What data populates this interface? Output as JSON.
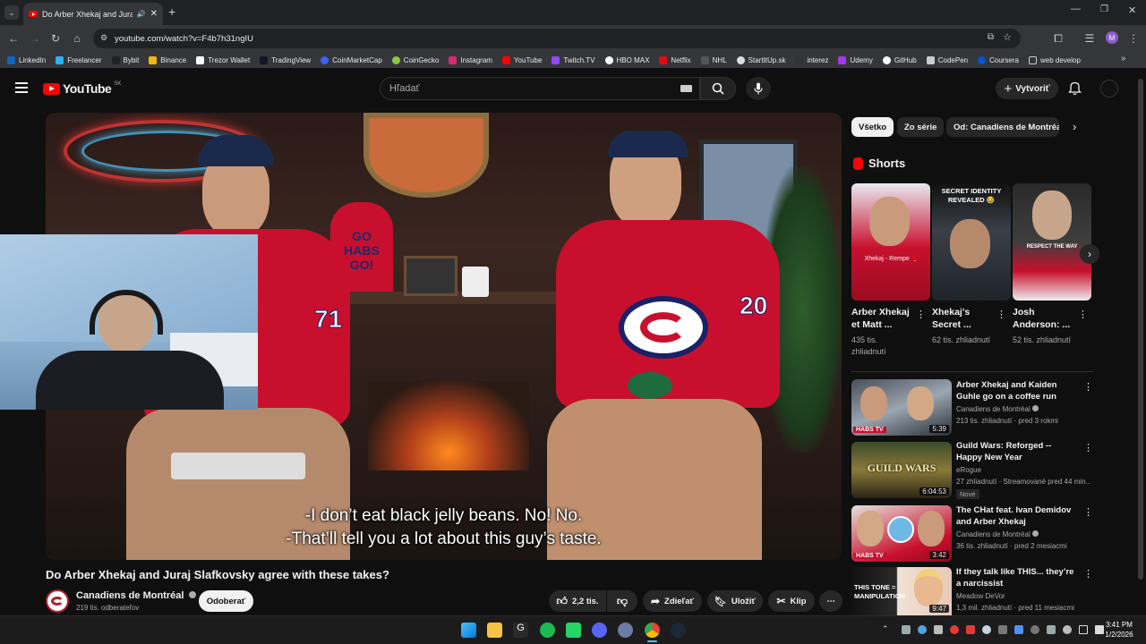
{
  "browser": {
    "tab_title": "Do Arber Xhekaj and Juraj Sla",
    "url": "youtube.com/watch?v=F4b7h31ngIU",
    "bookmarks": [
      "LinkedIn",
      "Freelancer",
      "Bybit",
      "Binance",
      "Trezor Wallet",
      "TradingView",
      "CoinMarketCap",
      "CoinGecko",
      "Instagram",
      "YouTube",
      "Twitch.TV",
      "HBO MAX",
      "Netflix",
      "NHL",
      "StartItUp.sk",
      "interez",
      "Udemy",
      "GitHub",
      "CodePen",
      "Coursera",
      "web develop"
    ]
  },
  "youtube": {
    "logo_text": "YouTube",
    "region": "SK",
    "search_placeholder": "Hľadať",
    "create_label": "Vytvoriť"
  },
  "video": {
    "captions": [
      "-I don’t eat black jelly beans. No! No.",
      "-That’ll tell you a lot about this guy’s taste."
    ],
    "title": "Do Arber Xhekaj and Juraj Slafkovsky agree with these takes?",
    "channel": "Canadiens de Montréal",
    "subscribers": "219 tis. odberateľov",
    "subscribe_label": "Odoberať",
    "likes": "2,2 tis.",
    "share_label": "Zdieľať",
    "save_label": "Uložiť",
    "clip_label": "Klip",
    "jersey_numbers": [
      "71",
      "20"
    ],
    "sign_text": "GO HABS GO!"
  },
  "sidebar": {
    "chips": [
      "Všetko",
      "Zo série",
      "Od: Canadiens de Montréal"
    ],
    "shorts_heading": "Shorts",
    "shorts": [
      {
        "title": "Arber Xhekaj et Matt ...",
        "views": "435 tis. zhliadnutí",
        "overlay": "Xhekaj - Rempe 🥊"
      },
      {
        "title": "Xhekaj's Secret ...",
        "views": "62 tis. zhliadnutí",
        "overlay": "SECRET IDENTITY REVEALED 😂"
      },
      {
        "title": "Josh Anderson: ...",
        "views": "52 tis. zhliadnutí",
        "overlay": "RESPECT THE WAY"
      }
    ],
    "recommended": [
      {
        "title": "Arber Xhekaj and Kaiden Guhle go on a coffee run",
        "channel": "Canadiens de Montréal",
        "meta": "213 tis. zhliadnutí · pred 3 rokmi",
        "duration": "5:39",
        "badge": "",
        "thumb_text": "HABS TV"
      },
      {
        "title": "Guild Wars: Reforged -- Happy New Year",
        "channel": "eRogue",
        "meta": "27 zhliadnutí · Streamované pred 44 min...",
        "duration": "6:04:53",
        "badge": "Nové",
        "thumb_text": "GUILD WARS"
      },
      {
        "title": "The CHat feat. Ivan Demidov and Arber Xhekaj",
        "channel": "Canadiens de Montréal",
        "meta": "36 tis. zhliadnutí · pred 2 mesiacmi",
        "duration": "3:42",
        "badge": "",
        "thumb_text": "HABS TV"
      },
      {
        "title": "If they talk like THIS... they’re a narcissist",
        "channel": "Meadow DeVor",
        "meta": "1,3 mil. zhliadnutí · pred 11 mesiacmi",
        "duration": "9:47",
        "badge": "",
        "thumb_text": "THIS TONE = MANIPULATION"
      }
    ]
  },
  "taskbar": {
    "time": "3:41 PM",
    "date": "1/2/2026"
  },
  "colors": {
    "youtube_red": "#ff0000",
    "habs_red": "#af1e2d",
    "habs_blue": "#192168",
    "background": "#0f0f0f"
  }
}
